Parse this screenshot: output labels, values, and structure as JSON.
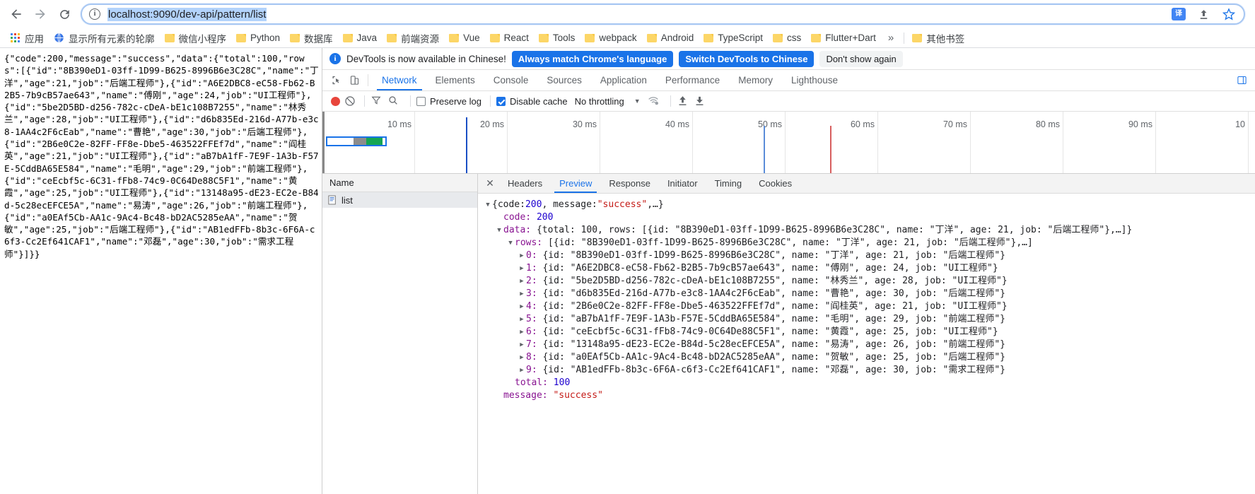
{
  "browser": {
    "nav": {
      "back": "back-arrow",
      "forward": "forward-arrow",
      "reload": "reload-arrow"
    },
    "omnibox": {
      "info_icon": "info-circle-icon",
      "url": "localhost:9090/dev-api/pattern/list",
      "translate_label": "译",
      "share_icon": "share-icon",
      "star_icon": "star-icon"
    },
    "bookmarks": [
      {
        "label": "应用",
        "icon": "apps-grid-icon"
      },
      {
        "label": "显示所有元素的轮廓",
        "icon": "globe-icon"
      },
      {
        "label": "微信小程序",
        "icon": "folder-icon"
      },
      {
        "label": "Python",
        "icon": "folder-icon"
      },
      {
        "label": "数据库",
        "icon": "folder-icon"
      },
      {
        "label": "Java",
        "icon": "folder-icon"
      },
      {
        "label": "前端资源",
        "icon": "folder-icon"
      },
      {
        "label": "Vue",
        "icon": "folder-icon"
      },
      {
        "label": "React",
        "icon": "folder-icon"
      },
      {
        "label": "Tools",
        "icon": "folder-icon"
      },
      {
        "label": "webpack",
        "icon": "folder-icon"
      },
      {
        "label": "Android",
        "icon": "folder-icon"
      },
      {
        "label": "TypeScript",
        "icon": "folder-icon"
      },
      {
        "label": "css",
        "icon": "folder-icon"
      },
      {
        "label": "Flutter+Dart",
        "icon": "folder-icon"
      }
    ],
    "bookmarks_overflow": "»",
    "other_bookmarks": {
      "label": "其他书签",
      "icon": "folder-icon"
    }
  },
  "page_body": {
    "raw_json": "{\"code\":200,\"message\":\"success\",\"data\":{\"total\":100,\"rows\":[{\"id\":\"8B390eD1-03ff-1D99-B625-8996B6e3C28C\",\"name\":\"丁洋\",\"age\":21,\"job\":\"后端工程师\"},{\"id\":\"A6E2DBC8-eC58-Fb62-B2B5-7b9cB57ae643\",\"name\":\"傅刚\",\"age\":24,\"job\":\"UI工程师\"},{\"id\":\"5be2D5BD-d256-782c-cDeA-bE1c108B7255\",\"name\":\"林秀兰\",\"age\":28,\"job\":\"UI工程师\"},{\"id\":\"d6b835Ed-216d-A77b-e3c8-1AA4c2F6cEab\",\"name\":\"曹艳\",\"age\":30,\"job\":\"后端工程师\"},{\"id\":\"2B6e0C2e-82FF-FF8e-Dbe5-463522FFEf7d\",\"name\":\"阎桂英\",\"age\":21,\"job\":\"UI工程师\"},{\"id\":\"aB7bA1fF-7E9F-1A3b-F57E-5CddBA65E584\",\"name\":\"毛明\",\"age\":29,\"job\":\"前端工程师\"},{\"id\":\"ceEcbf5c-6C31-fFb8-74c9-0C64De88C5F1\",\"name\":\"黄霞\",\"age\":25,\"job\":\"UI工程师\"},{\"id\":\"13148a95-dE23-EC2e-B84d-5c28ecEFCE5A\",\"name\":\"易涛\",\"age\":26,\"job\":\"前端工程师\"},{\"id\":\"a0EAf5Cb-AA1c-9Ac4-Bc48-bD2AC5285eAA\",\"name\":\"贺敏\",\"age\":25,\"job\":\"后端工程师\"},{\"id\":\"AB1edFFb-8b3c-6F6A-c6f3-Cc2Ef641CAF1\",\"name\":\"邓磊\",\"age\":30,\"job\":\"需求工程师\"}]}}"
  },
  "devtools": {
    "banner": {
      "info_icon": "info-icon",
      "message": "DevTools is now available in Chinese!",
      "primary_button": "Always match Chrome's language",
      "secondary_button": "Switch DevTools to Chinese",
      "dismiss_button": "Don't show again"
    },
    "inspect_icon": "inspect-cursor-icon",
    "device_icon": "device-toolbar-icon",
    "tabs": [
      {
        "label": "Network",
        "active": true
      },
      {
        "label": "Elements",
        "active": false
      },
      {
        "label": "Console",
        "active": false
      },
      {
        "label": "Sources",
        "active": false
      },
      {
        "label": "Application",
        "active": false
      },
      {
        "label": "Performance",
        "active": false
      },
      {
        "label": "Memory",
        "active": false
      },
      {
        "label": "Lighthouse",
        "active": false
      }
    ],
    "toolbar": {
      "record_icon": "record-stop-icon",
      "clear_icon": "clear-no-entry-icon",
      "filter_icon": "funnel-filter-icon",
      "search_icon": "search-magnifier-icon",
      "preserve_log": {
        "label": "Preserve log",
        "checked": false
      },
      "disable_cache": {
        "label": "Disable cache",
        "checked": true
      },
      "throttling": "No throttling",
      "throttle_caret": "▼",
      "wifi_icon": "network-conditions-icon",
      "import_icon": "import-har-up-arrow-icon",
      "export_icon": "export-har-down-arrow-icon"
    },
    "overview": {
      "ticks": [
        "10 ms",
        "20 ms",
        "30 ms",
        "40 ms",
        "50 ms",
        "60 ms",
        "70 ms",
        "80 ms",
        "90 ms",
        "10"
      ],
      "dom_content_loaded_color": "#1a4fc4",
      "load_event_color": "#d75f5f",
      "request_bar_colors": {
        "border": "#1a73e8",
        "waiting": "#8c8c8c",
        "download": "#15a552"
      }
    },
    "request_list": {
      "header": "Name",
      "rows": [
        {
          "name": "list",
          "icon": "document-icon",
          "selected": true
        }
      ]
    },
    "detail": {
      "close_icon": "close-x-icon",
      "tabs": [
        {
          "label": "Headers",
          "active": false
        },
        {
          "label": "Preview",
          "active": true
        },
        {
          "label": "Response",
          "active": false
        },
        {
          "label": "Initiator",
          "active": false
        },
        {
          "label": "Timing",
          "active": false
        },
        {
          "label": "Cookies",
          "active": false
        }
      ],
      "preview": {
        "root": {
          "prefix": "{code: ",
          "code_val": "200",
          "mid": ", message: ",
          "msg_val": "\"success\"",
          "suffix": ",…}"
        },
        "code_line": {
          "key": "code:",
          "value": "200"
        },
        "data_line": {
          "key": "data:",
          "text": "{total: 100, rows: [{id: \"8B390eD1-03ff-1D99-B625-8996B6e3C28C\", name: \"丁洋\", age: 21, job: \"后端工程师\"},…]}"
        },
        "rows_line": {
          "key": "rows:",
          "text": "[{id: \"8B390eD1-03ff-1D99-B625-8996B6e3C28C\", name: \"丁洋\", age: 21, job: \"后端工程师\"},…]"
        },
        "items": [
          {
            "index": "0:",
            "text": "{id: \"8B390eD1-03ff-1D99-B625-8996B6e3C28C\", name: \"丁洋\", age: 21, job: \"后端工程师\"}"
          },
          {
            "index": "1:",
            "text": "{id: \"A6E2DBC8-eC58-Fb62-B2B5-7b9cB57ae643\", name: \"傅刚\", age: 24, job: \"UI工程师\"}"
          },
          {
            "index": "2:",
            "text": "{id: \"5be2D5BD-d256-782c-cDeA-bE1c108B7255\", name: \"林秀兰\", age: 28, job: \"UI工程师\"}"
          },
          {
            "index": "3:",
            "text": "{id: \"d6b835Ed-216d-A77b-e3c8-1AA4c2F6cEab\", name: \"曹艳\", age: 30, job: \"后端工程师\"}"
          },
          {
            "index": "4:",
            "text": "{id: \"2B6e0C2e-82FF-FF8e-Dbe5-463522FFEf7d\", name: \"阎桂英\", age: 21, job: \"UI工程师\"}"
          },
          {
            "index": "5:",
            "text": "{id: \"aB7bA1fF-7E9F-1A3b-F57E-5CddBA65E584\", name: \"毛明\", age: 29, job: \"前端工程师\"}"
          },
          {
            "index": "6:",
            "text": "{id: \"ceEcbf5c-6C31-fFb8-74c9-0C64De88C5F1\", name: \"黄霞\", age: 25, job: \"UI工程师\"}"
          },
          {
            "index": "7:",
            "text": "{id: \"13148a95-dE23-EC2e-B84d-5c28ecEFCE5A\", name: \"易涛\", age: 26, job: \"前端工程师\"}"
          },
          {
            "index": "8:",
            "text": "{id: \"a0EAf5Cb-AA1c-9Ac4-Bc48-bD2AC5285eAA\", name: \"贺敏\", age: 25, job: \"后端工程师\"}"
          },
          {
            "index": "9:",
            "text": "{id: \"AB1edFFb-8b3c-6F6A-c6f3-Cc2Ef641CAF1\", name: \"邓磊\", age: 30, job: \"需求工程师\"}"
          }
        ],
        "total_line": {
          "key": "total:",
          "value": "100"
        },
        "message_line": {
          "key": "message:",
          "value": "\"success\""
        }
      }
    }
  }
}
